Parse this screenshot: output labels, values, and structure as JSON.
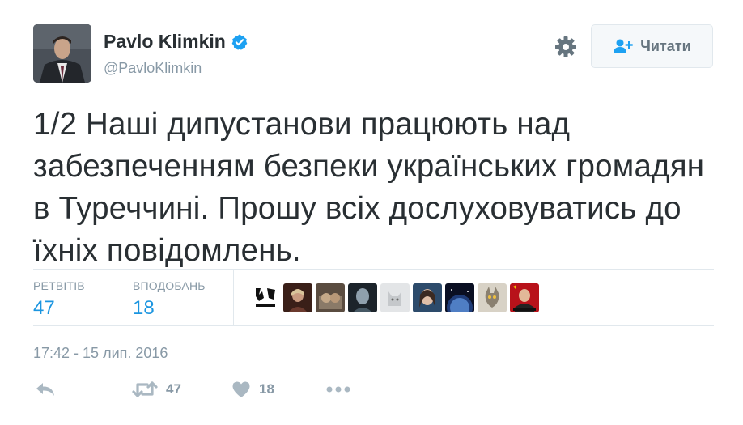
{
  "user": {
    "name": "Pavlo Klimkin",
    "handle": "@PavloKlimkin",
    "avatar_icon": "avatar-photo",
    "verified_color": "#1da1f2"
  },
  "follow_button": {
    "label": "Читати",
    "icon": "add-user-icon"
  },
  "settings_icon": "gear-icon",
  "tweet": {
    "text": "1/2 Наші дипустанови працюють над забезпеченням безпеки українських громадян в Туреччині. Прошу всіх дослуховуватись до їхніх повідомлень.",
    "timestamp": "17:42 - 15 лип. 2016"
  },
  "stats": {
    "retweets_label": "РЕТВІТІВ",
    "retweets_value": "47",
    "likes_label": "ВПОДОБАНЬ",
    "likes_value": "18"
  },
  "likers": [
    {
      "name": "liker-avatar-1",
      "color": "#ffffff"
    },
    {
      "name": "liker-avatar-2",
      "color": "#6b3a2e"
    },
    {
      "name": "liker-avatar-3",
      "color": "#7a6a5a"
    },
    {
      "name": "liker-avatar-4",
      "color": "#3a4650"
    },
    {
      "name": "liker-avatar-5",
      "color": "#d6d8da"
    },
    {
      "name": "liker-avatar-6",
      "color": "#4a6f96"
    },
    {
      "name": "liker-avatar-7",
      "color": "#0f1628"
    },
    {
      "name": "liker-avatar-8",
      "color": "#c8c0b0"
    },
    {
      "name": "liker-avatar-9",
      "color": "#b8121a"
    }
  ],
  "actions": {
    "reply_icon": "reply-icon",
    "retweet_icon": "retweet-icon",
    "retweet_count": "47",
    "like_icon": "heart-icon",
    "like_count": "18",
    "more_icon": "more-dots-icon"
  },
  "colors": {
    "accent": "#1b95e0",
    "muted": "#8899a6",
    "icon": "#aab8c2"
  }
}
